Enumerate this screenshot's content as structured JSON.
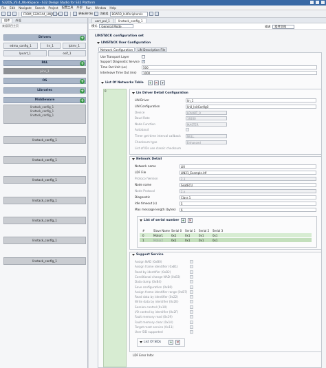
{
  "window": {
    "title": "S32DS_V3.4_WorkSpace - S32 Design Studio for S32 Platform"
  },
  "menu": [
    "File",
    "Edit",
    "Navigate",
    "Search",
    "Project",
    "配置工具",
    "外部",
    "Run",
    "Window",
    "Help"
  ],
  "toolbar": {
    "project_combo": "FRDM_S32K144_LIN_Master",
    "update_label": "更新源代码",
    "function_label": "功能组",
    "board_combo": "BOARD_InitPeripherals"
  },
  "left": {
    "tab_active": "组件",
    "tab_other": "外设",
    "subtitle": "来组项目主页",
    "categories": {
      "drivers": "Drivers",
      "pal": "PAL",
      "os": "OS",
      "libraries": "Libraries",
      "middleware": "Middleware"
    },
    "drivers_items": [
      "edma_config_1",
      "lin_1",
      "lptmr_1",
      "lpuart_1",
      "osif_1"
    ],
    "pal_selected": "pins_1",
    "middleware_group": [
      "linstack_config_1",
      "linstack_config_1",
      "linstack_config_1"
    ],
    "linstack_items": [
      "linstack_config_1",
      "linstack_config_1",
      "linstack_config_1",
      "linstack_config_1",
      "linstack_config_1",
      "linstack_config_1",
      "linstack_config_1"
    ]
  },
  "editor": {
    "tabs": [
      "uart_pal_1",
      "linstack_config_1"
    ],
    "mode_label": "模式",
    "mode_value": "General Mode",
    "doc_label": "描述",
    "doc_value": "组件文档",
    "title": "LINSTACK configuration set",
    "user_config": "LINSTACK User Configuration",
    "subtabs": [
      "Network Configuration",
      "LIN Description File"
    ],
    "top_fields": {
      "transport_layer": "Use Transport Layer",
      "diag_service": "Support Diagnostic Service",
      "time_out_unit": "Time Out Unit (us)",
      "time_out_unit_value": "500",
      "interleave": "Interleave Time Out (ms)",
      "interleave_value": "1000"
    },
    "list_networks": "List Of Networks Table",
    "network_index": "0",
    "lin_driver": {
      "header": "Lin Driver Detail Configuration",
      "lin_driver": "LIN Driver",
      "lin_driver_value": "lin_1",
      "lin_config": "LIN Configuration",
      "lin_config_value": "lin0_InitConfig0",
      "device": "Device",
      "device_value": "LPUART_0",
      "baud_rate": "Baud Rate",
      "baud_rate_value": "19200",
      "node_function": "Node Function",
      "node_function_value": "MASTER",
      "autobaud": "Autobaud",
      "timer_get": "Timer get time interval callback",
      "timer_get_value": "NULL",
      "checksum": "Checksum type",
      "checksum_value": "Enhanced",
      "list_ids": "List of IDs use classic checksum"
    },
    "network": {
      "header": "Network Detail",
      "name": "Network name",
      "name_value": "LI0",
      "ldf": "LDF File",
      "ldf_value": "LIN21_Example.ldf",
      "protocol": "Protocol Version",
      "protocol_value": "2.1",
      "node_name": "Node name",
      "node_name_value": "SeatECU",
      "node_protocol": "Node Protocol",
      "node_protocol_value": "2.x",
      "diagnostic": "Diagnostic",
      "diagnostic_value": "Class 1",
      "idle": "Idle timeout (s)",
      "idle_value": "5",
      "max_msg": "Max message length (bytes)",
      "max_msg_value": "6"
    },
    "serial": {
      "header": "List of serial number",
      "columns": [
        "#",
        "Slave Name",
        "Serial 0",
        "Serial 1",
        "Serial 2",
        "Serial 3"
      ],
      "rows": [
        [
          "0",
          "Motor1",
          "0x1",
          "0x1",
          "0x1",
          "0x1"
        ],
        [
          "1",
          "Motor2",
          "0x1",
          "0x1",
          "0x1",
          "0x1"
        ]
      ]
    },
    "support": {
      "header": "Support Service",
      "items": [
        "Assign NAD (0xB0)",
        "Assign frame identifier (0xB1)",
        "Read by identifier (0xB2)",
        "Conditional change NAD (0xB3)",
        "Data dump (0xB4)",
        "Save configuration (0xB6)",
        "Assign frame identifier range (0xB7)",
        "Read data by identifier (0x22)",
        "Write data by identifier (0x2E)",
        "Session control (0x10)",
        "I/O control by identifier (0x2F)",
        "Fault memory read (0x19)",
        "Fault memory clear (0x14)",
        "Target reset service (0x11)",
        "User SID supported"
      ],
      "list_sids": "List Of SIDs",
      "ldf_error": "LDF Error Infor"
    }
  }
}
